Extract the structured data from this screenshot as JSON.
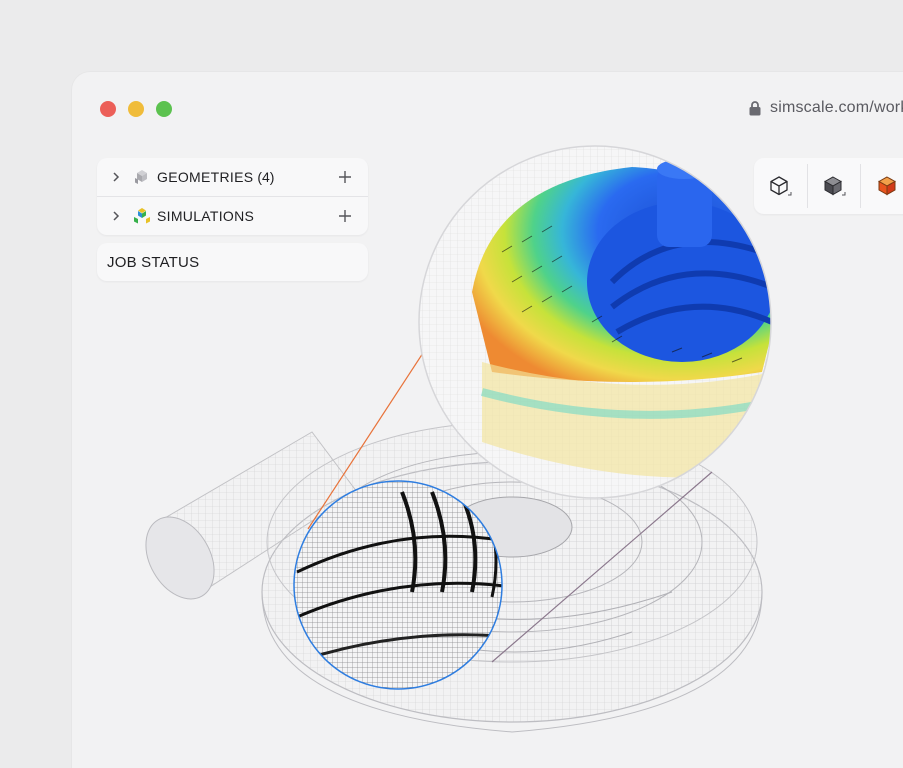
{
  "window": {
    "url": "simscale.com/work"
  },
  "sidebar": {
    "items": [
      {
        "label": "GEOMETRIES",
        "count": "(4)"
      },
      {
        "label": "SIMULATIONS",
        "count": ""
      }
    ],
    "job_status_label": "JOB STATUS"
  },
  "toolbar": {
    "buttons": [
      {
        "icon": "wireframe-cube-icon"
      },
      {
        "icon": "solid-cube-icon"
      },
      {
        "icon": "colored-cube-icon"
      }
    ]
  },
  "viewport": {
    "model": "pump-volute-mesh",
    "zoom_callouts": [
      "cfd-velocity-result-zoom",
      "mesh-detail-zoom"
    ]
  },
  "colors": {
    "close": "#ec5f58",
    "minimize": "#f0bc3a",
    "maximize": "#5cc24f",
    "accent_orange": "#e8733a",
    "accent_blue": "#2e7de0"
  }
}
